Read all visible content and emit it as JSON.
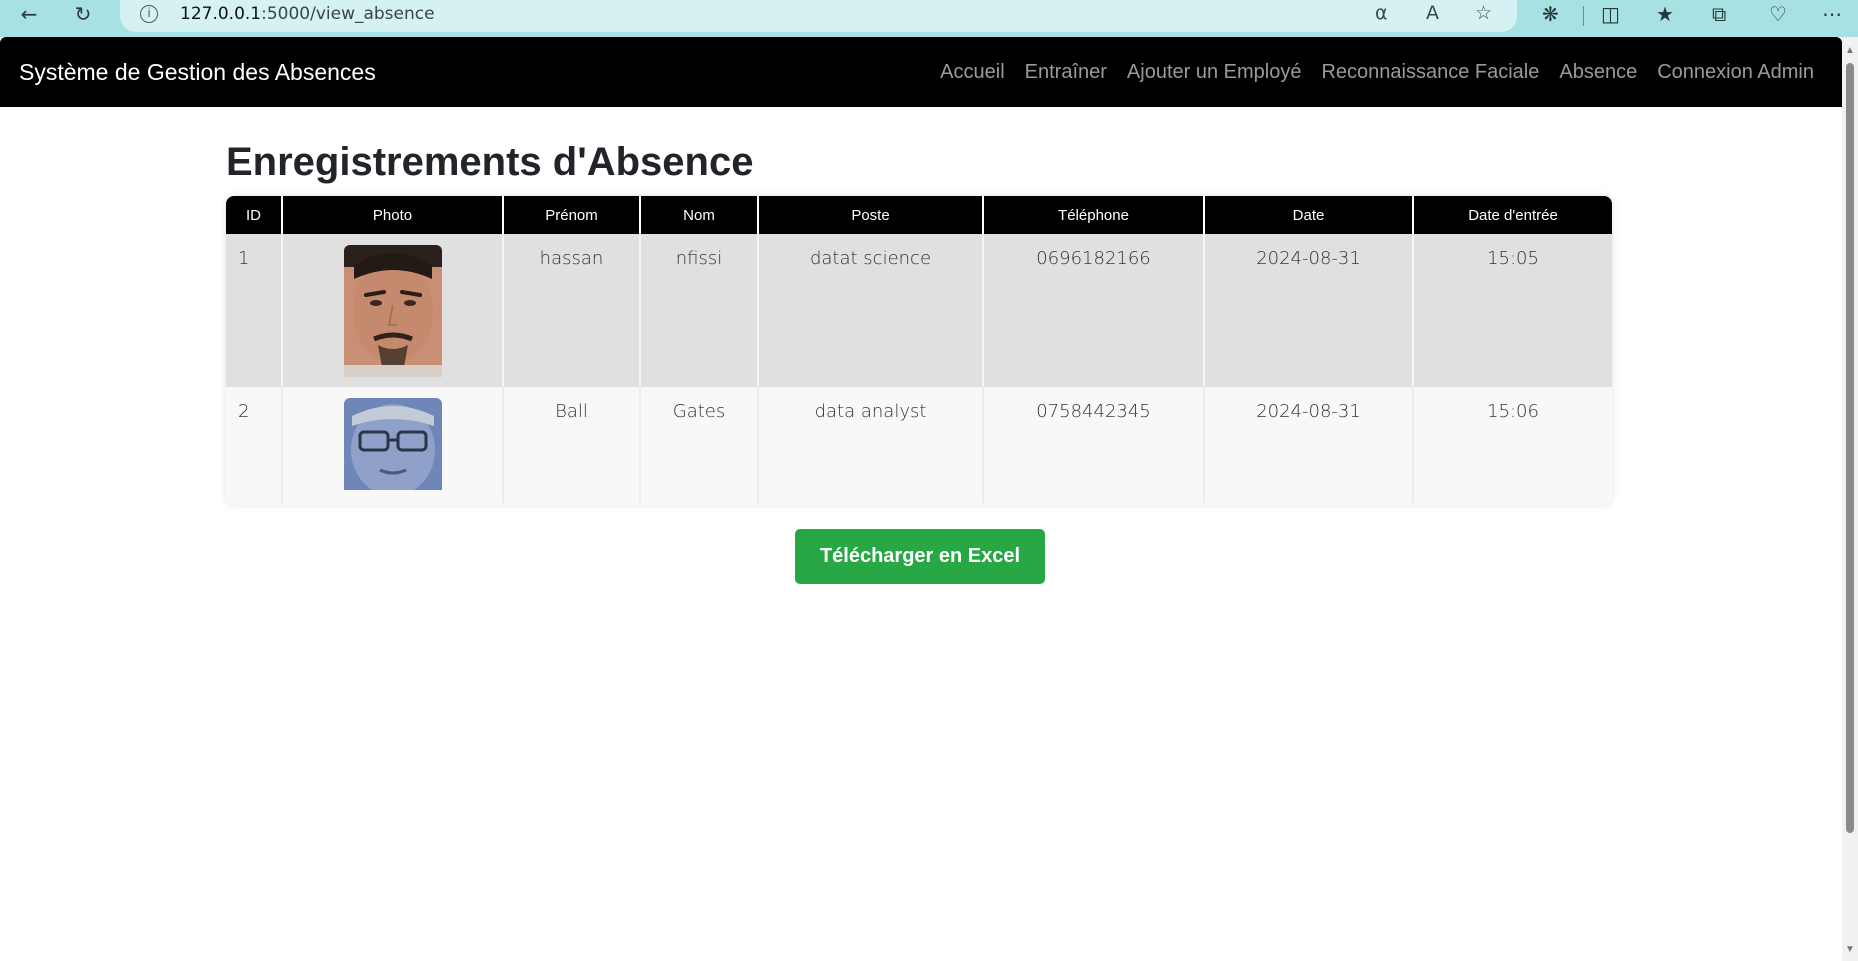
{
  "browser": {
    "url_host": "127.0.0.1",
    "url_path": ":5000/view_absence",
    "info_glyph": "i"
  },
  "navbar": {
    "brand": "Système de Gestion des Absences",
    "links": [
      "Accueil",
      "Entraîner",
      "Ajouter un Employé",
      "Reconnaissance Faciale",
      "Absence",
      "Connexion Admin"
    ]
  },
  "main": {
    "title": "Enregistrements d'Absence",
    "table": {
      "headers": [
        "ID",
        "Photo",
        "Prénom",
        "Nom",
        "Poste",
        "Téléphone",
        "Date",
        "Date d'entrée"
      ],
      "rows": [
        {
          "id": "1",
          "prenom": "hassan",
          "nom": "nfissi",
          "poste": "datat science",
          "telephone": "0696182166",
          "date": "2024-08-31",
          "date_entree": "15:05"
        },
        {
          "id": "2",
          "prenom": "Ball",
          "nom": "Gates",
          "poste": "data analyst",
          "telephone": "0758442345",
          "date": "2024-08-31",
          "date_entree": "15:06"
        }
      ]
    },
    "download_button": "Télécharger en Excel"
  },
  "colors": {
    "navbar_bg": "#000000",
    "button_green": "#28a745",
    "browser_bar": "#a8e1e3"
  }
}
